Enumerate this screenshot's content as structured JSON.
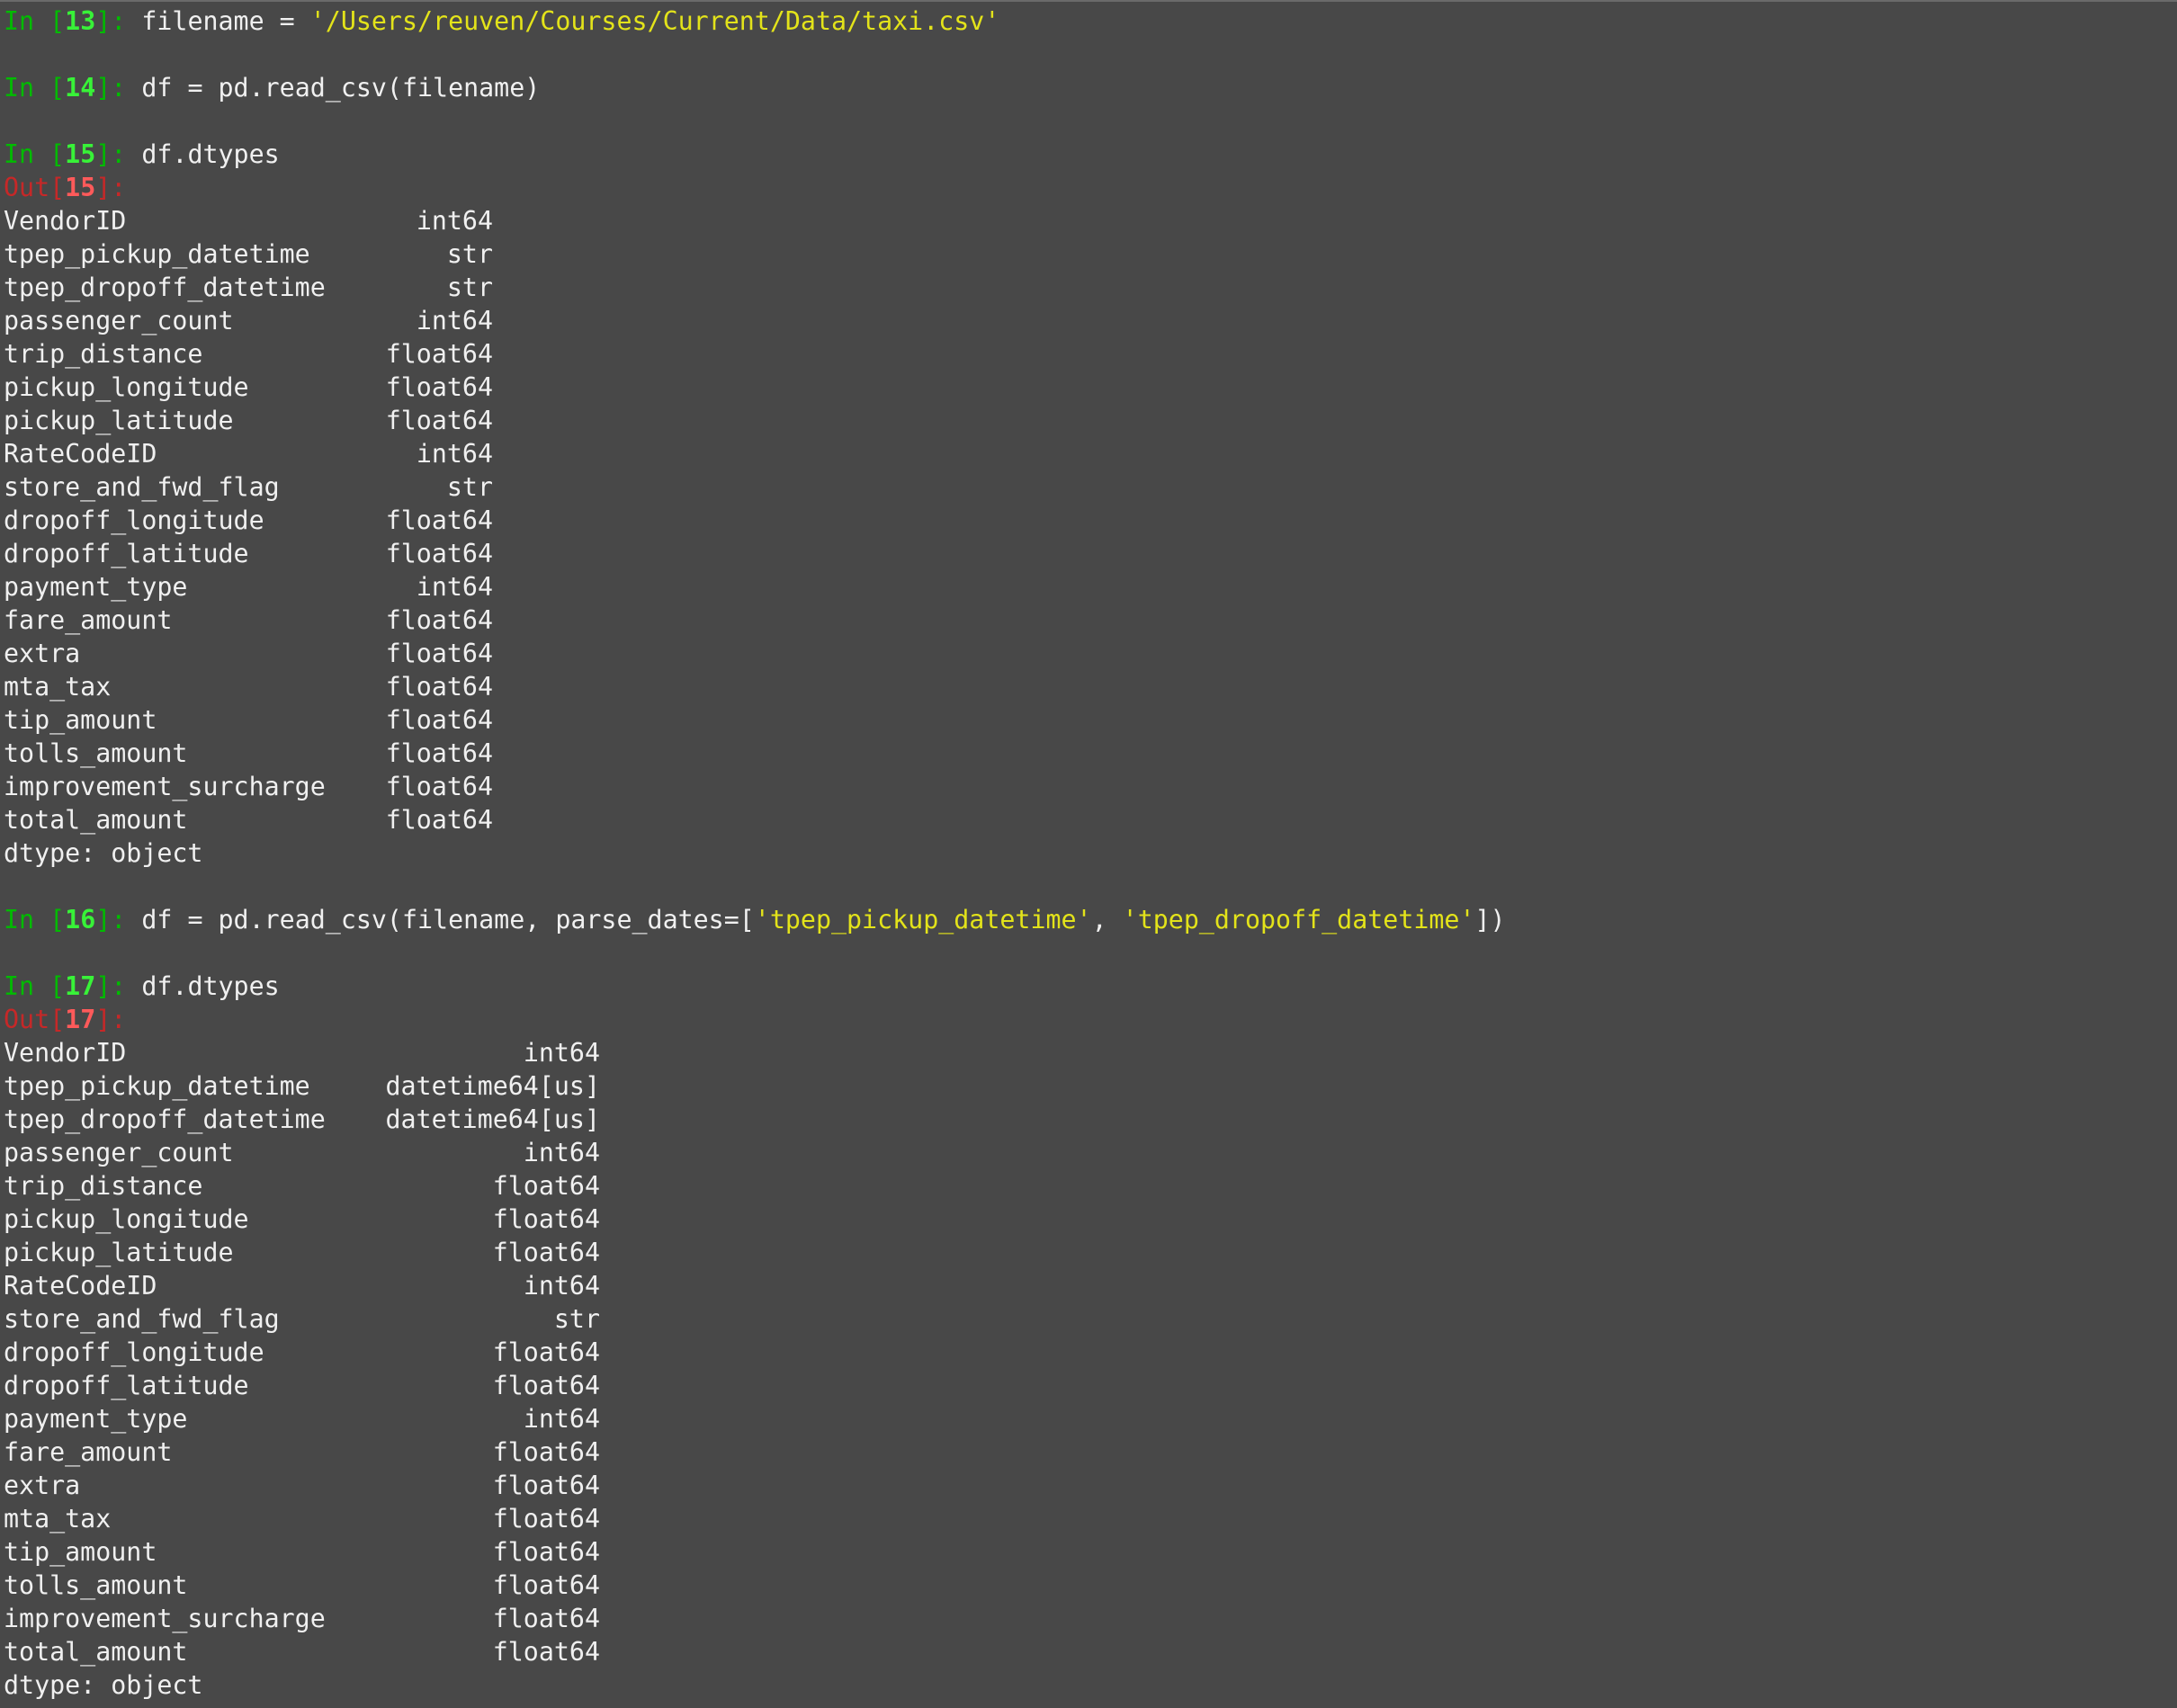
{
  "cells": [
    {
      "in": "13",
      "code_pre": "filename = ",
      "string": "'/Users/reuven/Courses/Current/Data/taxi.csv'"
    },
    {
      "in": "14",
      "code": "df = pd.read_csv(filename)"
    },
    {
      "in": "15",
      "code": "df.dtypes",
      "out": "15"
    },
    {
      "in": "16",
      "code_pre": "df = pd.read_csv(filename, parse_dates=[",
      "str1": "'tpep_pickup_datetime'",
      "mid": ", ",
      "str2": "'tpep_dropoff_datetime'",
      "code_post": "])"
    },
    {
      "in": "17",
      "code": "df.dtypes",
      "out": "17"
    }
  ],
  "labels": {
    "in_word": "In ",
    "out_word": "Out",
    "bracket_open": "[",
    "bracket_close": "]: ",
    "out_close": "]:"
  },
  "table1": [
    {
      "name": "VendorID",
      "type": "int64"
    },
    {
      "name": "tpep_pickup_datetime",
      "type": "str"
    },
    {
      "name": "tpep_dropoff_datetime",
      "type": "str"
    },
    {
      "name": "passenger_count",
      "type": "int64"
    },
    {
      "name": "trip_distance",
      "type": "float64"
    },
    {
      "name": "pickup_longitude",
      "type": "float64"
    },
    {
      "name": "pickup_latitude",
      "type": "float64"
    },
    {
      "name": "RateCodeID",
      "type": "int64"
    },
    {
      "name": "store_and_fwd_flag",
      "type": "str"
    },
    {
      "name": "dropoff_longitude",
      "type": "float64"
    },
    {
      "name": "dropoff_latitude",
      "type": "float64"
    },
    {
      "name": "payment_type",
      "type": "int64"
    },
    {
      "name": "fare_amount",
      "type": "float64"
    },
    {
      "name": "extra",
      "type": "float64"
    },
    {
      "name": "mta_tax",
      "type": "float64"
    },
    {
      "name": "tip_amount",
      "type": "float64"
    },
    {
      "name": "tolls_amount",
      "type": "float64"
    },
    {
      "name": "improvement_surcharge",
      "type": "float64"
    },
    {
      "name": "total_amount",
      "type": "float64"
    }
  ],
  "table2": [
    {
      "name": "VendorID",
      "type": "int64"
    },
    {
      "name": "tpep_pickup_datetime",
      "type": "datetime64[us]"
    },
    {
      "name": "tpep_dropoff_datetime",
      "type": "datetime64[us]"
    },
    {
      "name": "passenger_count",
      "type": "int64"
    },
    {
      "name": "trip_distance",
      "type": "float64"
    },
    {
      "name": "pickup_longitude",
      "type": "float64"
    },
    {
      "name": "pickup_latitude",
      "type": "float64"
    },
    {
      "name": "RateCodeID",
      "type": "int64"
    },
    {
      "name": "store_and_fwd_flag",
      "type": "str"
    },
    {
      "name": "dropoff_longitude",
      "type": "float64"
    },
    {
      "name": "dropoff_latitude",
      "type": "float64"
    },
    {
      "name": "payment_type",
      "type": "int64"
    },
    {
      "name": "fare_amount",
      "type": "float64"
    },
    {
      "name": "extra",
      "type": "float64"
    },
    {
      "name": "mta_tax",
      "type": "float64"
    },
    {
      "name": "tip_amount",
      "type": "float64"
    },
    {
      "name": "tolls_amount",
      "type": "float64"
    },
    {
      "name": "improvement_surcharge",
      "type": "float64"
    },
    {
      "name": "total_amount",
      "type": "float64"
    }
  ],
  "dtype_footer": "dtype: object",
  "colors": {
    "background": "#484848",
    "prompt_in": "#00bb00",
    "prompt_in_num": "#38f238",
    "prompt_out": "#c62828",
    "prompt_out_num": "#ff5a5a",
    "string": "#e3e31a",
    "text": "#f0f0f0"
  }
}
